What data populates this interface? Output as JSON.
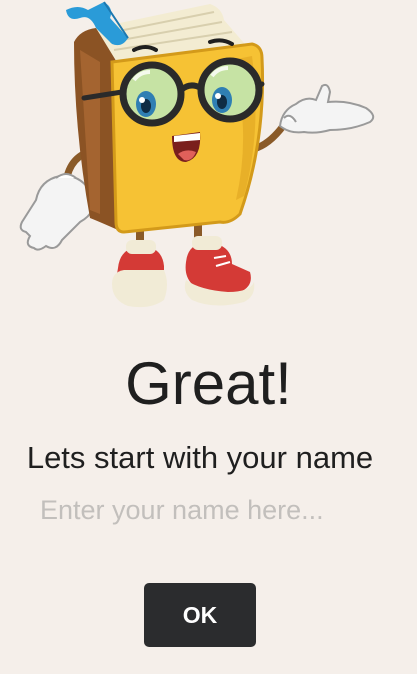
{
  "mascot": {
    "icon": "book-mascot-icon"
  },
  "heading": {
    "title": "Great!",
    "subtitle": "Lets start with your name"
  },
  "form": {
    "name_value": "",
    "name_placeholder": "Enter your name here...",
    "ok_label": "OK"
  },
  "colors": {
    "background": "#f5efea",
    "text": "#1f1f1f",
    "placeholder": "#c2bfbc",
    "button": "#2b2c2e",
    "button_text": "#ffffff"
  }
}
